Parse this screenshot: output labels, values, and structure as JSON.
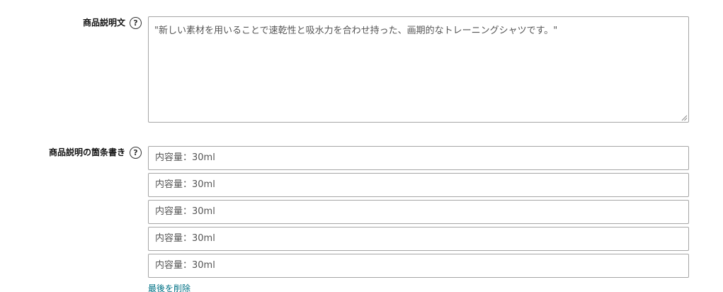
{
  "description": {
    "label": "商品説明文",
    "help_icon": "?",
    "value": "\"新しい素材を用いることで速乾性と吸水力を合わせ持った、画期的なトレーニングシャツです。\""
  },
  "bullets": {
    "label": "商品説明の箇条書き",
    "help_icon": "?",
    "items": [
      "内容量：30ml",
      "内容量：30ml",
      "内容量：30ml",
      "内容量：30ml",
      "内容量：30ml"
    ],
    "remove_last_label": "最後を削除"
  },
  "colors": {
    "link": "#007185",
    "border": "#a6a6a6",
    "input_text": "#555555"
  }
}
